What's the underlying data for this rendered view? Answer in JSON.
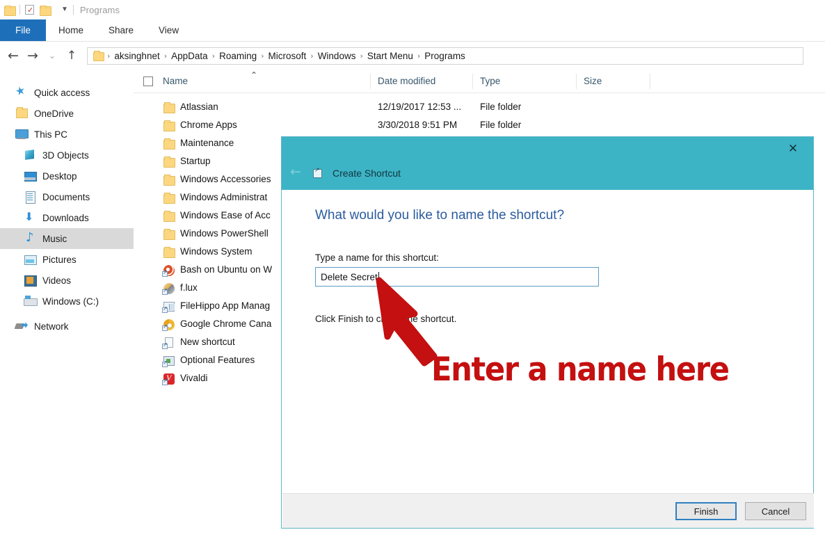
{
  "window": {
    "title": "Programs",
    "quick_access_icons": [
      "folder-icon",
      "properties-icon",
      "new-folder-icon",
      "customize-dropdown-icon"
    ],
    "ribbon_tabs": [
      {
        "label": "File",
        "active": true
      },
      {
        "label": "Home",
        "active": false
      },
      {
        "label": "Share",
        "active": false
      },
      {
        "label": "View",
        "active": false
      }
    ]
  },
  "navbar": {
    "back_icon": "←",
    "forward_icon": "→",
    "recent_icon": "⌄",
    "up_icon": "↑",
    "breadcrumbs": [
      "aksinghnet",
      "AppData",
      "Roaming",
      "Microsoft",
      "Windows",
      "Start Menu",
      "Programs"
    ],
    "separator": "›"
  },
  "sidebar": {
    "items": [
      {
        "label": "Quick access",
        "icon": "star-icon",
        "indent": false,
        "selected": false
      },
      {
        "label": "OneDrive",
        "icon": "onedrive-folder-icon",
        "indent": false,
        "selected": false
      },
      {
        "label": "This PC",
        "icon": "this-pc-icon",
        "indent": false,
        "selected": false
      },
      {
        "label": "3D Objects",
        "icon": "3d-objects-icon",
        "indent": true,
        "selected": false
      },
      {
        "label": "Desktop",
        "icon": "desktop-icon",
        "indent": true,
        "selected": false
      },
      {
        "label": "Documents",
        "icon": "documents-icon",
        "indent": true,
        "selected": false
      },
      {
        "label": "Downloads",
        "icon": "downloads-icon",
        "indent": true,
        "selected": false
      },
      {
        "label": "Music",
        "icon": "music-icon",
        "indent": true,
        "selected": true
      },
      {
        "label": "Pictures",
        "icon": "pictures-icon",
        "indent": true,
        "selected": false
      },
      {
        "label": "Videos",
        "icon": "videos-icon",
        "indent": true,
        "selected": false
      },
      {
        "label": "Windows (C:)",
        "icon": "drive-icon",
        "indent": true,
        "selected": false
      },
      {
        "label": "Network",
        "icon": "network-icon",
        "indent": false,
        "selected": false
      }
    ]
  },
  "filelist": {
    "columns": [
      "Name",
      "Date modified",
      "Type",
      "Size"
    ],
    "sort_indicator": "⌃",
    "rows": [
      {
        "name": "Atlassian",
        "icon": "folder-icon",
        "date": "12/19/2017 12:53 ...",
        "type": "File folder",
        "size": ""
      },
      {
        "name": "Chrome Apps",
        "icon": "folder-icon",
        "date": "3/30/2018 9:51 PM",
        "type": "File folder",
        "size": ""
      },
      {
        "name": "Maintenance",
        "icon": "folder-icon",
        "date": "",
        "type": "",
        "size": ""
      },
      {
        "name": "Startup",
        "icon": "folder-icon",
        "date": "",
        "type": "",
        "size": ""
      },
      {
        "name": "Windows Accessories",
        "icon": "folder-icon",
        "date": "",
        "type": "",
        "size": ""
      },
      {
        "name": "Windows Administrat",
        "icon": "folder-icon",
        "date": "",
        "type": "",
        "size": ""
      },
      {
        "name": "Windows Ease of Acc",
        "icon": "folder-icon",
        "date": "",
        "type": "",
        "size": ""
      },
      {
        "name": "Windows PowerShell",
        "icon": "folder-icon",
        "date": "",
        "type": "",
        "size": ""
      },
      {
        "name": "Windows System",
        "icon": "folder-icon",
        "date": "",
        "type": "",
        "size": ""
      },
      {
        "name": "Bash on Ubuntu on W",
        "icon": "bash-shortcut-icon",
        "date": "",
        "type": "",
        "size": ""
      },
      {
        "name": "f.lux",
        "icon": "flux-shortcut-icon",
        "date": "",
        "type": "",
        "size": ""
      },
      {
        "name": "FileHippo App Manag",
        "icon": "filehippo-shortcut-icon",
        "date": "",
        "type": "",
        "size": ""
      },
      {
        "name": "Google Chrome Cana",
        "icon": "chrome-canary-shortcut-icon",
        "date": "",
        "type": "",
        "size": ""
      },
      {
        "name": "New shortcut",
        "icon": "new-shortcut-icon",
        "date": "",
        "type": "",
        "size": ""
      },
      {
        "name": "Optional Features",
        "icon": "optional-features-shortcut-icon",
        "date": "",
        "type": "",
        "size": ""
      },
      {
        "name": "Vivaldi",
        "icon": "vivaldi-shortcut-icon",
        "date": "",
        "type": "",
        "size": ""
      }
    ]
  },
  "dialog": {
    "title": "Create Shortcut",
    "back_icon": "←",
    "close_icon": "✕",
    "heading": "What would you like to name the shortcut?",
    "field_label": "Type a name for this shortcut:",
    "input_value": "Delete Secret",
    "input_placeholder": "",
    "hint": "Click Finish to create the shortcut.",
    "finish_label": "Finish",
    "cancel_label": "Cancel",
    "accent_color": "#3cb4c6"
  },
  "annotation": {
    "text": "Enter a name here",
    "color": "#c41010",
    "arrow": "red-arrow-pointing-to-input"
  }
}
